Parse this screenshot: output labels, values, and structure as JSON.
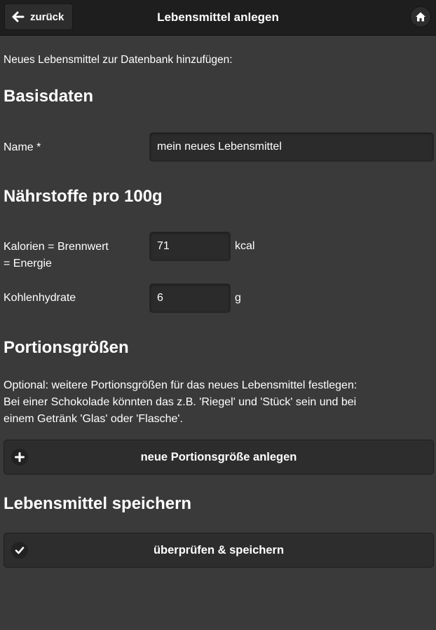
{
  "header": {
    "back_label": "zurück",
    "title": "Lebensmittel anlegen",
    "home_icon": "home-icon"
  },
  "intro": "Neues Lebensmittel zur Datenbank hinzufügen:",
  "sections": {
    "basis": "Basisdaten",
    "naehrstoffe": "Nährstoffe pro 100g",
    "portionen": "Portionsgrößen",
    "speichern": "Lebensmittel speichern"
  },
  "fields": {
    "name": {
      "label": "Name *",
      "value": "mein neues Lebensmittel"
    },
    "kalorien": {
      "label_line1": "Kalorien = Brennwert",
      "label_line2": "= Energie",
      "value": "71",
      "unit": "kcal"
    },
    "kohlenhydrate": {
      "label": "Kohlenhydrate",
      "value": "6",
      "unit": "g"
    }
  },
  "portion_desc": [
    "Optional: weitere Portionsgrößen für das neues Lebensmittel festlegen:",
    "Bei einer Schokolade könnten das z.B. 'Riegel' und 'Stück' sein und bei",
    "einem Getränk 'Glas' oder 'Flasche'."
  ],
  "buttons": {
    "add_portion": "neue Portionsgröße anlegen",
    "save": "überprüfen & speichern"
  },
  "colors": {
    "background": "#3a3a3a",
    "header": "#1e1e1e",
    "button": "#2d2d2d",
    "text": "#ffffff"
  }
}
